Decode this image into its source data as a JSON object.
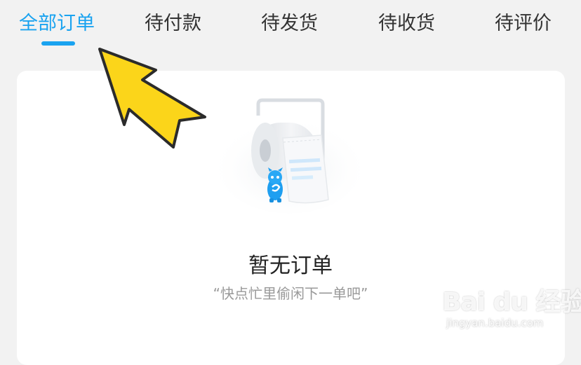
{
  "tabs": [
    {
      "label": "全部订单",
      "active": true
    },
    {
      "label": "待付款",
      "active": false
    },
    {
      "label": "待发货",
      "active": false
    },
    {
      "label": "待收货",
      "active": false
    },
    {
      "label": "待评价",
      "active": false
    }
  ],
  "empty_state": {
    "title": "暂无订单",
    "subtitle": "“快点忙里偷闲下一单吧”"
  },
  "watermark": {
    "logo_text": "Bai du 经验",
    "url": "jingyan.baidu.com"
  },
  "colors": {
    "accent": "#1aa3f0",
    "background": "#f2f2f2",
    "card": "#ffffff",
    "title_text": "#222222",
    "subtitle_text": "#999999",
    "tab_text": "#333333",
    "annotation_arrow": "#fbd51a"
  },
  "icons": {
    "arrow": "annotation-arrow-icon",
    "empty": "receipt-roll-mascot-icon"
  }
}
